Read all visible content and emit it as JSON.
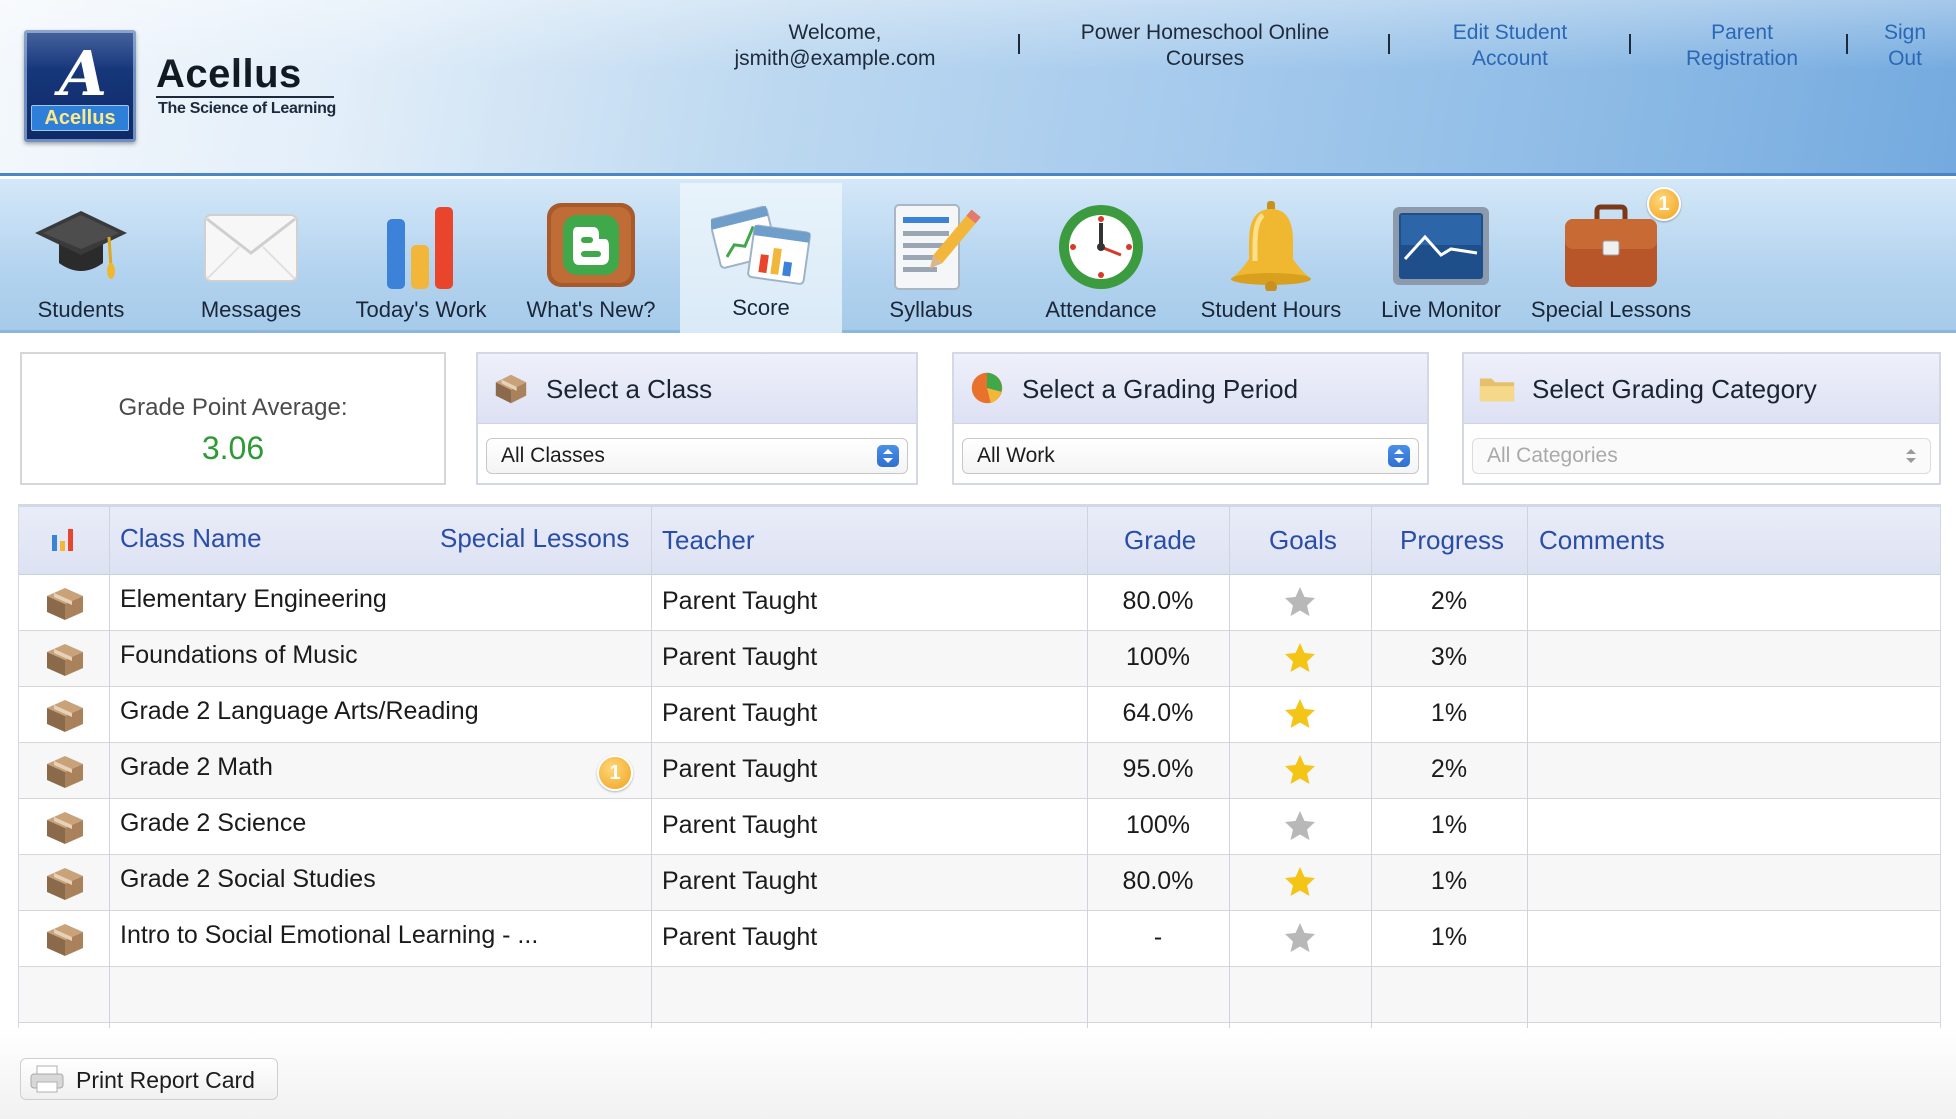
{
  "header": {
    "brand_logo_text": "Acellus",
    "brand_name": "Acellus",
    "brand_tagline": "The Science of Learning",
    "welcome_line1": "Welcome,",
    "welcome_line2": "jsmith@example.com",
    "courses_line1": "Power Homeschool Online",
    "courses_line2": "Courses",
    "edit_line1": "Edit Student",
    "edit_line2": "Account",
    "parent_line1": "Parent",
    "parent_line2": "Registration",
    "signout_line1": "Sign",
    "signout_line2": "Out"
  },
  "toolbar": {
    "items": [
      {
        "label": "Students",
        "icon": "graduation-cap-icon"
      },
      {
        "label": "Messages",
        "icon": "envelope-icon"
      },
      {
        "label": "Today's Work",
        "icon": "bar-chart-icon"
      },
      {
        "label": "What's New?",
        "icon": "blogger-icon"
      },
      {
        "label": "Score",
        "icon": "calendar-chart-icon",
        "active": true
      },
      {
        "label": "Syllabus",
        "icon": "syllabus-pencil-icon"
      },
      {
        "label": "Attendance",
        "icon": "clock-icon"
      },
      {
        "label": "Student Hours",
        "icon": "bell-icon"
      },
      {
        "label": "Live Monitor",
        "icon": "monitor-icon"
      },
      {
        "label": "Special Lessons",
        "icon": "briefcase-icon",
        "badge": "1"
      }
    ]
  },
  "gpa": {
    "label": "Grade Point Average:",
    "value": "3.06"
  },
  "filters": {
    "class": {
      "title": "Select a Class",
      "value": "All Classes"
    },
    "period": {
      "title": "Select a Grading Period",
      "value": "All Work"
    },
    "category": {
      "title": "Select Grading Category",
      "value": "All Categories",
      "disabled": true
    }
  },
  "table": {
    "headers": {
      "class_name": "Class Name",
      "special_lessons": "Special Lessons",
      "teacher": "Teacher",
      "grade": "Grade",
      "goals": "Goals",
      "progress": "Progress",
      "comments": "Comments"
    },
    "rows": [
      {
        "class_name": "Elementary Engineering",
        "teacher": "Parent Taught",
        "grade": "80.0%",
        "goal_met": false,
        "progress": "2%",
        "comments": ""
      },
      {
        "class_name": "Foundations of Music",
        "teacher": "Parent Taught",
        "grade": "100%",
        "goal_met": true,
        "progress": "3%",
        "comments": ""
      },
      {
        "class_name": "Grade 2 Language Arts/Reading",
        "teacher": "Parent Taught",
        "grade": "64.0%",
        "goal_met": true,
        "progress": "1%",
        "comments": ""
      },
      {
        "class_name": "Grade 2 Math",
        "teacher": "Parent Taught",
        "grade": "95.0%",
        "goal_met": true,
        "progress": "2%",
        "comments": "",
        "special_lessons_badge": "1"
      },
      {
        "class_name": "Grade 2 Science",
        "teacher": "Parent Taught",
        "grade": "100%",
        "goal_met": false,
        "progress": "1%",
        "comments": ""
      },
      {
        "class_name": "Grade 2 Social Studies",
        "teacher": "Parent Taught",
        "grade": "80.0%",
        "goal_met": true,
        "progress": "1%",
        "comments": ""
      },
      {
        "class_name": "Intro to Social Emotional Learning - ...",
        "teacher": "Parent Taught",
        "grade": "-",
        "goal_met": false,
        "progress": "1%",
        "comments": ""
      }
    ]
  },
  "footer": {
    "print_label": "Print Report Card"
  },
  "colors": {
    "link_blue": "#2a68b5",
    "header_text_blue": "#2a4da8",
    "gpa_green": "#2e9a35",
    "star_gold": "#f4c416",
    "star_gray": "#b8b8b8",
    "badge_orange": "#f0a21e"
  }
}
